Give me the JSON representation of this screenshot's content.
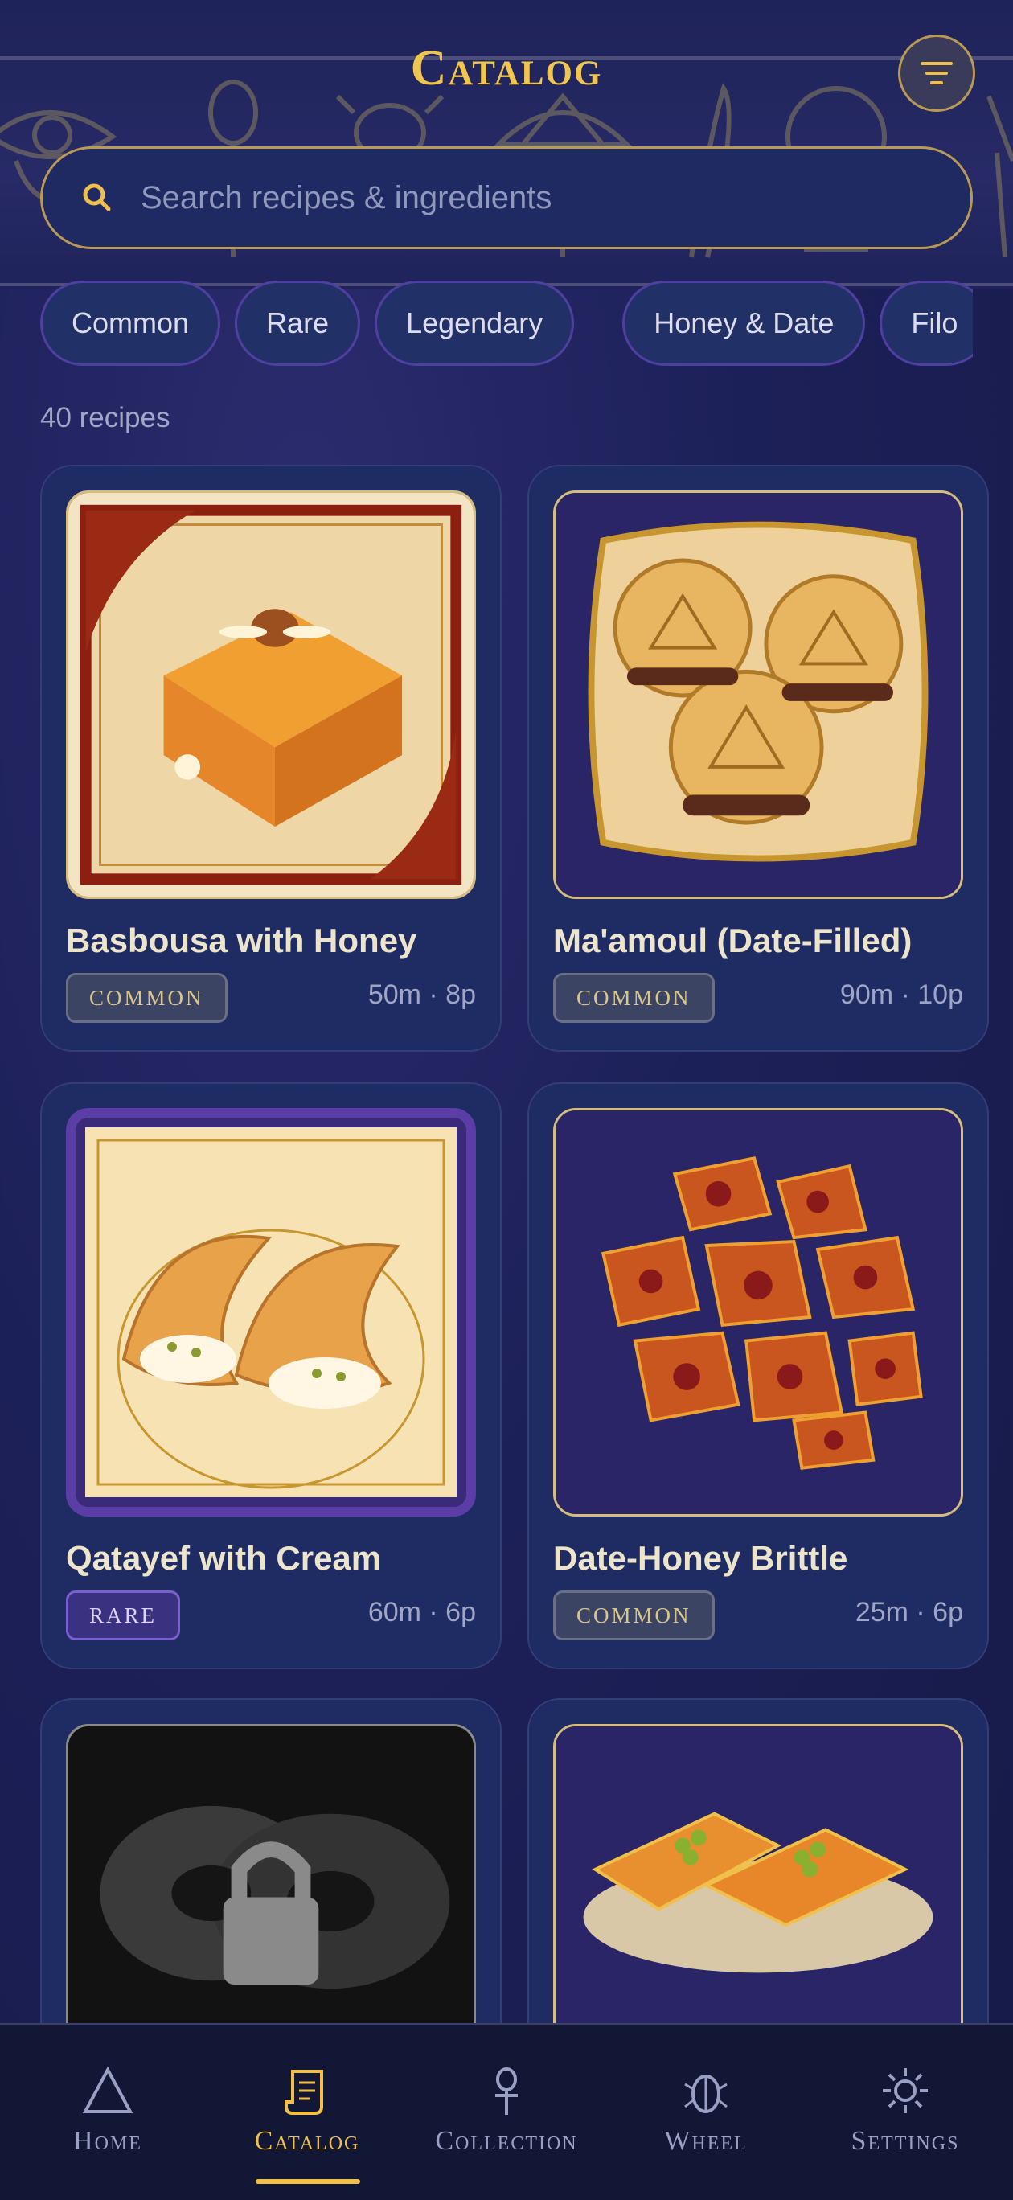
{
  "header": {
    "title": "Catalog",
    "search_placeholder": "Search recipes & ingredients"
  },
  "filters": [
    "Common",
    "Rare",
    "Legendary",
    "Honey & Date",
    "Filo"
  ],
  "recipe_count": "40 recipes",
  "recipes": [
    {
      "name": "Basbousa with Honey",
      "rarity": "COMMON",
      "meta": "50m · 8p"
    },
    {
      "name": "Ma'amoul (Date-Filled)",
      "rarity": "COMMON",
      "meta": "90m · 10p"
    },
    {
      "name": "Qatayef with Cream",
      "rarity": "RARE",
      "meta": "60m · 6p"
    },
    {
      "name": "Date-Honey Brittle",
      "rarity": "COMMON",
      "meta": "25m · 6p"
    },
    {
      "name": "",
      "rarity": "",
      "meta": "",
      "locked": true
    },
    {
      "name": "",
      "rarity": "",
      "meta": ""
    }
  ],
  "nav": [
    {
      "label": "Home",
      "icon": "pyramid-icon"
    },
    {
      "label": "Catalog",
      "icon": "scroll-icon",
      "active": true
    },
    {
      "label": "Collection",
      "icon": "ankh-icon"
    },
    {
      "label": "Wheel",
      "icon": "scarab-icon"
    },
    {
      "label": "Settings",
      "icon": "sun-gear-icon"
    }
  ],
  "colors": {
    "accent_gold": "#f0c04a",
    "background": "#1c2058",
    "card": "#1f2b63",
    "rare_purple": "#5a3ea5"
  }
}
